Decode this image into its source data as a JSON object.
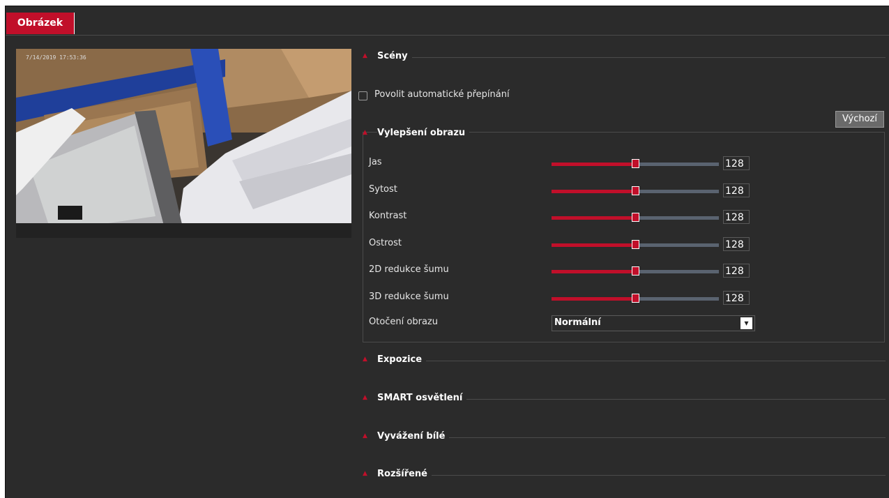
{
  "tabs": [
    {
      "label": "Obrázek",
      "active": true
    }
  ],
  "preview": {
    "osd_text": "7/14/2019 17:53:36"
  },
  "scenes": {
    "title": "Scény",
    "auto_switch_label": "Povolit automatické přepínání",
    "auto_switch_checked": false
  },
  "default_button": "Výchozí",
  "enhancement": {
    "title": "Vylepšení obrazu",
    "rows": [
      {
        "label": "Jas",
        "value": "128",
        "level": 0.5
      },
      {
        "label": "Sytost",
        "value": "128",
        "level": 0.5
      },
      {
        "label": "Kontrast",
        "value": "128",
        "level": 0.5
      },
      {
        "label": "Ostrost",
        "value": "128",
        "level": 0.5
      },
      {
        "label": "2D redukce šumu",
        "value": "128",
        "level": 0.5
      },
      {
        "label": "3D redukce šumu",
        "value": "128",
        "level": 0.5
      }
    ],
    "rotation": {
      "label": "Otočení obrazu",
      "value": "Normální"
    }
  },
  "sections": [
    {
      "title": "Expozice"
    },
    {
      "title": "SMART osvětlení"
    },
    {
      "title": "Vyvážení bílé"
    },
    {
      "title": "Rozšířené"
    }
  ],
  "colors": {
    "accent": "#c10f2a",
    "background": "#2b2b2b",
    "slider_track": "#5a6370"
  },
  "icons": {
    "section_toggle": "caret-up-icon",
    "dropdown": "chevron-down-icon"
  }
}
